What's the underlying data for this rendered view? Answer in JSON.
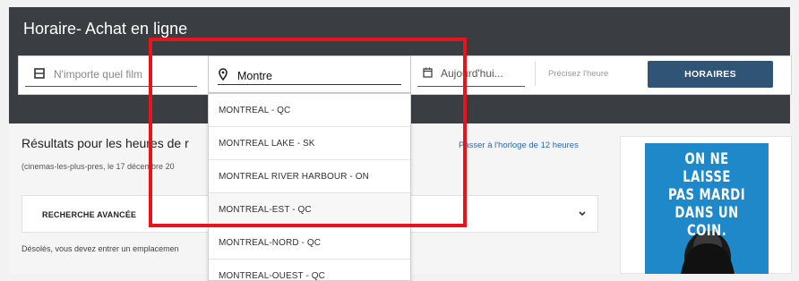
{
  "page": {
    "title": "Horaire- Achat en ligne"
  },
  "search": {
    "film_placeholder": "N'importe quel film",
    "location_value": "Montre",
    "date_value": "Aujourd'hui...",
    "time_hint": "Précisez l'heure",
    "submit_label": "HORAIRES"
  },
  "dropdown": {
    "items": [
      "MONTREAL - QC",
      "MONTREAL LAKE - SK",
      "MONTREAL RIVER HARBOUR - ON",
      "MONTREAL-EST - QC",
      "MONTREAL-NORD - QC",
      "MONTREAL-OUEST - QC"
    ]
  },
  "results": {
    "title": "Résultats pour les heures de r",
    "subtitle": "(cinemas-les-plus-pres, le 17 décembre 20",
    "clock_link": "Passer à l'horloge de 12 heures"
  },
  "advanced": {
    "label": "RECHERCHE AVANCÉE"
  },
  "error": {
    "text": "Désolés, vous devez entrer un emplacemen"
  },
  "ad": {
    "headline_lines": [
      "ON NE LAISSE",
      "PAS MARDI",
      "DANS UN COIN."
    ]
  },
  "colors": {
    "header_bg": "#3a3d42",
    "button_bg": "#2f5476",
    "link": "#2a6aa6",
    "highlight": "#e8141c",
    "ad_bg": "#1e88c8"
  },
  "icons": {
    "film": "film-icon",
    "location": "map-pin-icon",
    "date": "calendar-icon",
    "advanced": "chevron-down-icon"
  }
}
